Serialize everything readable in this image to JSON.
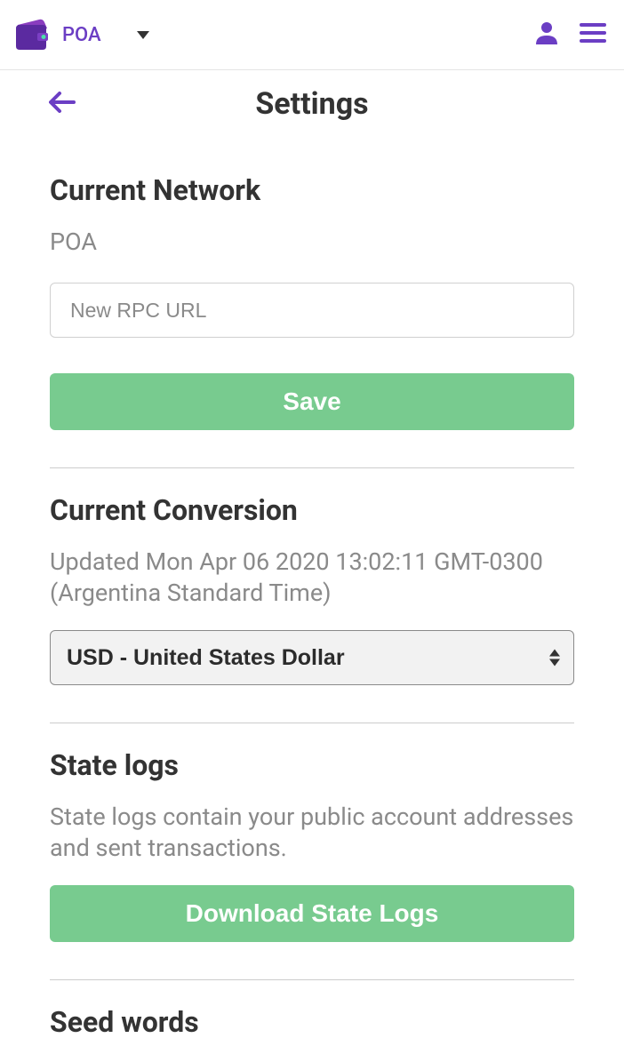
{
  "header": {
    "network_name": "POA"
  },
  "page": {
    "title": "Settings"
  },
  "current_network": {
    "title": "Current Network",
    "value": "POA",
    "rpc_placeholder": "New RPC URL",
    "save_label": "Save"
  },
  "current_conversion": {
    "title": "Current Conversion",
    "updated_text": "Updated Mon Apr 06 2020 13:02:11 GMT-0300 (Argentina Standard Time)",
    "selected_currency": "USD - United States Dollar"
  },
  "state_logs": {
    "title": "State logs",
    "description": "State logs contain your public account addresses and sent transactions.",
    "download_label": "Download State Logs"
  },
  "seed_words": {
    "title": "Seed words"
  }
}
